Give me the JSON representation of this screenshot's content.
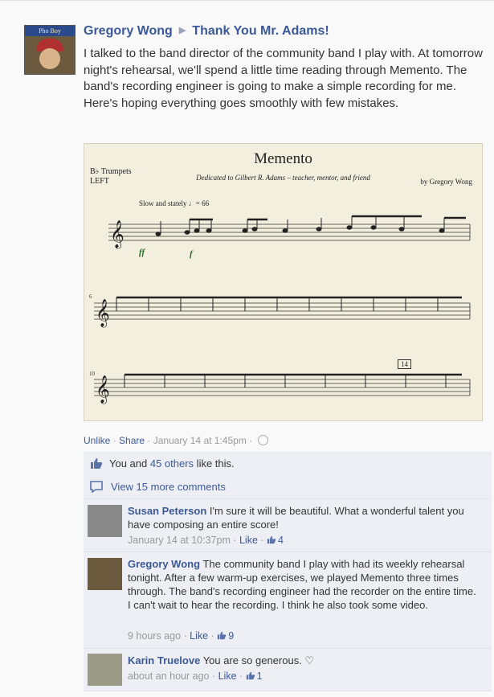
{
  "post": {
    "author": "Gregory Wong",
    "target": "Thank You Mr. Adams!",
    "text": "I talked to the band director of the community band I play with. At tomorrow night's rehearsal, we'll spend a little time reading through Memento. The band's recording engineer is going to make a simple recording for me. Here's hoping everything goes smoothly with few mistakes.",
    "avatar_band_text": "Pho Boy",
    "attachment": {
      "title": "Memento",
      "dedication": "Dedicated to Gilbert R. Adams – teacher, mentor, and friend",
      "instrument": "B♭ Trumpets",
      "part": "LEFT",
      "composer": "by Gregory Wong",
      "tempo": "Slow and stately ♩= 66",
      "rehearsal_mark": "14",
      "dyn1": "ff",
      "dyn2": "f",
      "measure2": "6",
      "measure3": "10"
    },
    "actions": {
      "unlike": "Unlike",
      "share": "Share",
      "timestamp": "January 14 at 1:45pm"
    },
    "likes": {
      "you": "You and ",
      "others": "45 others",
      "suffix": " like this."
    },
    "view_more": "View 15 more comments"
  },
  "comments": [
    {
      "author": "Susan Peterson",
      "text": "I'm sure it will be beautiful. What a wonderful talent you have composing an entire score!",
      "time": "January 14 at 10:37pm",
      "like": "Like",
      "count": "4"
    },
    {
      "author": "Gregory Wong",
      "text": "The community band I play with had its weekly rehearsal tonight. After a few warm-up exercises, we played Memento three times through. The band's recording engineer had the recorder on the entire time. I can't wait to hear the recording. I think he also took some video.",
      "time": "9 hours ago",
      "like": "Like",
      "count": "9"
    },
    {
      "author": "Karin Truelove",
      "text": "You are so generous. ♡",
      "time": "about an hour ago",
      "like": "Like",
      "count": "1"
    }
  ],
  "colors": {
    "link": "#3b5998",
    "panel": "#edeff4"
  }
}
